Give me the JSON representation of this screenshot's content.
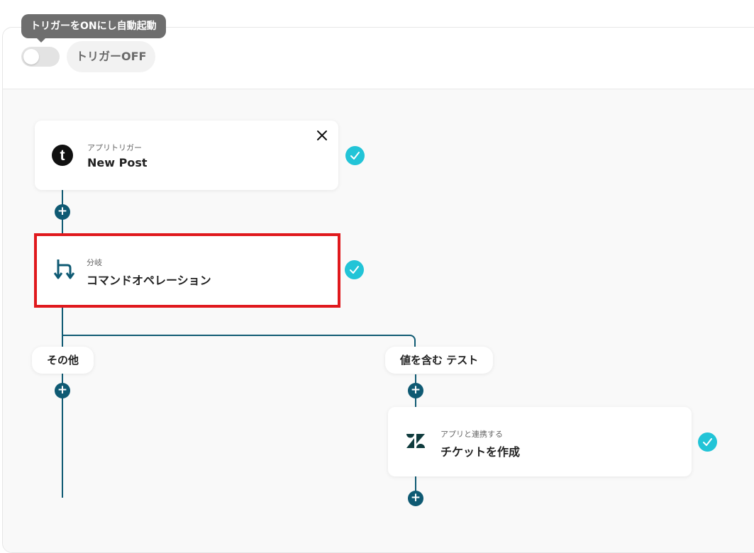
{
  "header": {
    "tooltip": "トリガーをONにし自動起動",
    "toggle_label": "トリガーOFF",
    "toggle_on": false
  },
  "steps": {
    "trigger": {
      "sub": "アプリトリガー",
      "title": "New Post",
      "icon": "tumblr-logo-icon"
    },
    "branch": {
      "sub": "分岐",
      "title": "コマンドオペレーション",
      "icon": "branch-icon"
    },
    "action": {
      "sub": "アプリと連携する",
      "title": "チケットを作成",
      "icon": "zendesk-logo-icon"
    }
  },
  "branches": {
    "left_label": "その他",
    "right_label": "値を含む テスト"
  },
  "colors": {
    "accent": "#0f5a73",
    "check": "#22c4d7",
    "highlight": "#e0191d"
  }
}
